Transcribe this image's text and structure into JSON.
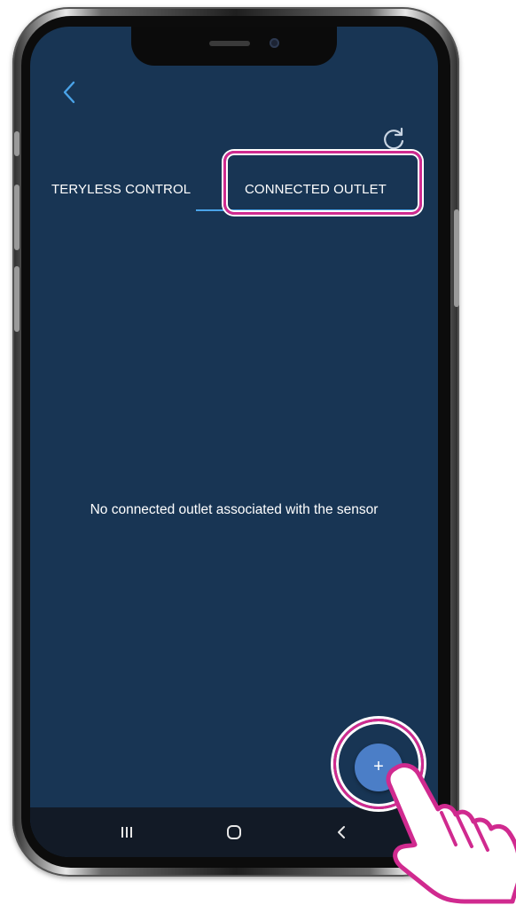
{
  "header": {
    "back_icon": "chevron-left-icon",
    "refresh_icon": "refresh-icon"
  },
  "tabs": [
    {
      "label": "TERYLESS CONTROL",
      "selected": false
    },
    {
      "label": "CONNECTED OUTLET",
      "selected": true
    }
  ],
  "main": {
    "empty_message": "No connected outlet associated with the sensor"
  },
  "fab": {
    "label": "+",
    "icon": "plus-icon"
  },
  "nav_bar": {
    "recent_icon": "recent-apps-icon",
    "home_icon": "home-icon",
    "back_icon": "back-icon"
  },
  "colors": {
    "screen_background": "#183554",
    "tab_indicator": "#4aa3e8",
    "highlight": "#d02a8f",
    "fab": "#4b7ec7"
  }
}
